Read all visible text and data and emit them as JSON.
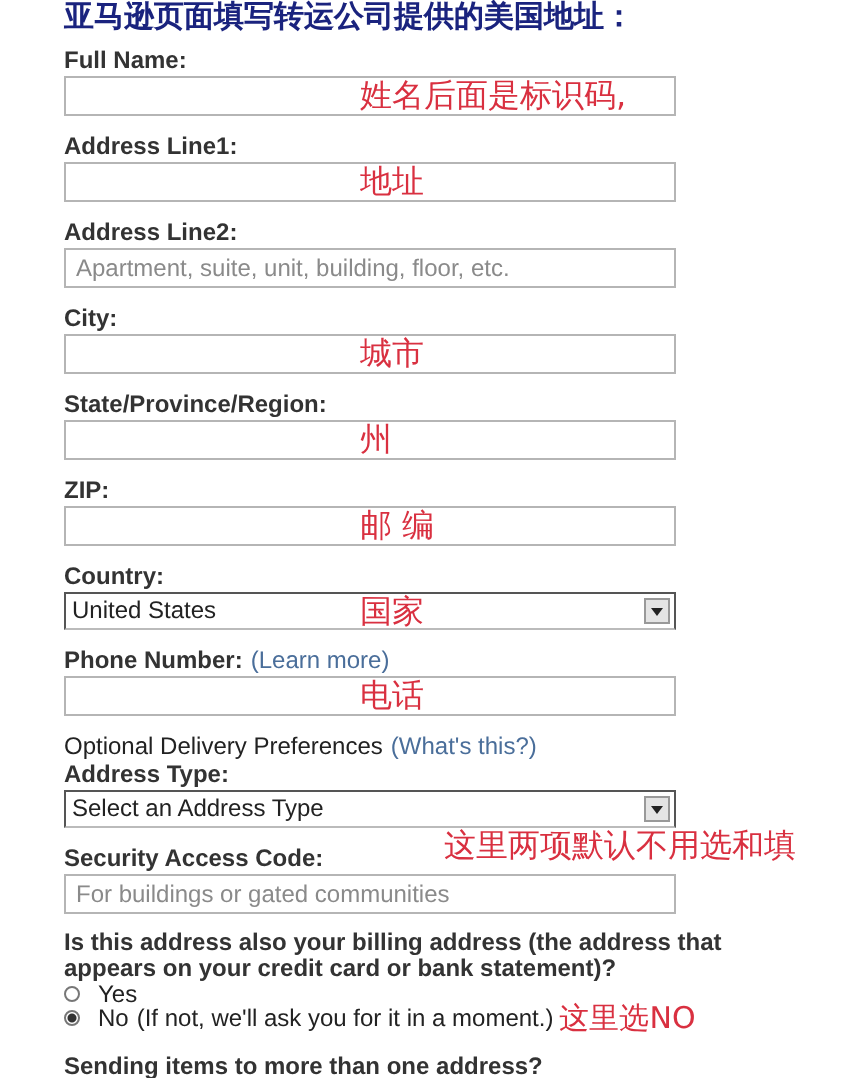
{
  "heading": "亚马逊页面填写转运公司提供的美国地址：",
  "fields": [
    {
      "label": "Full Name:",
      "kind": "text",
      "annotation": "姓名后面是标识码,"
    },
    {
      "label": "Address Line1:",
      "kind": "text",
      "annotation": "地址"
    },
    {
      "label": "Address Line2:",
      "kind": "text",
      "placeholder": "Apartment, suite, unit, building, floor, etc."
    },
    {
      "label": "City:",
      "kind": "text",
      "annotation": "城市"
    },
    {
      "label": "State/Province/Region:",
      "kind": "text",
      "annotation": "州"
    },
    {
      "label": "ZIP:",
      "kind": "text",
      "annotation": "邮 编"
    },
    {
      "label": "Country:",
      "kind": "select",
      "value": "United States",
      "annotation": "国家"
    },
    {
      "label": "Phone Number:",
      "kind": "text",
      "link": "(Learn more)",
      "annotation": "电话"
    },
    {
      "section": "Optional Delivery Preferences",
      "section_link": "(What's this?)",
      "label": "Address Type:",
      "kind": "select",
      "value": "Select an Address Type",
      "side_note": "这里两项默认不用选和填"
    },
    {
      "label": "Security Access Code:",
      "kind": "text",
      "placeholder": "For buildings or gated communities"
    }
  ],
  "billing": {
    "question": "Is this address also your billing address (the address that appears on your credit card or bank statement)?",
    "options": [
      {
        "label": "Yes",
        "selected": false
      },
      {
        "label": "No",
        "note": "(If not, we'll ask you for it in a moment.)",
        "annotation": "这里选NO",
        "selected": true
      }
    ]
  },
  "last_question": "Sending items to more than one address?"
}
